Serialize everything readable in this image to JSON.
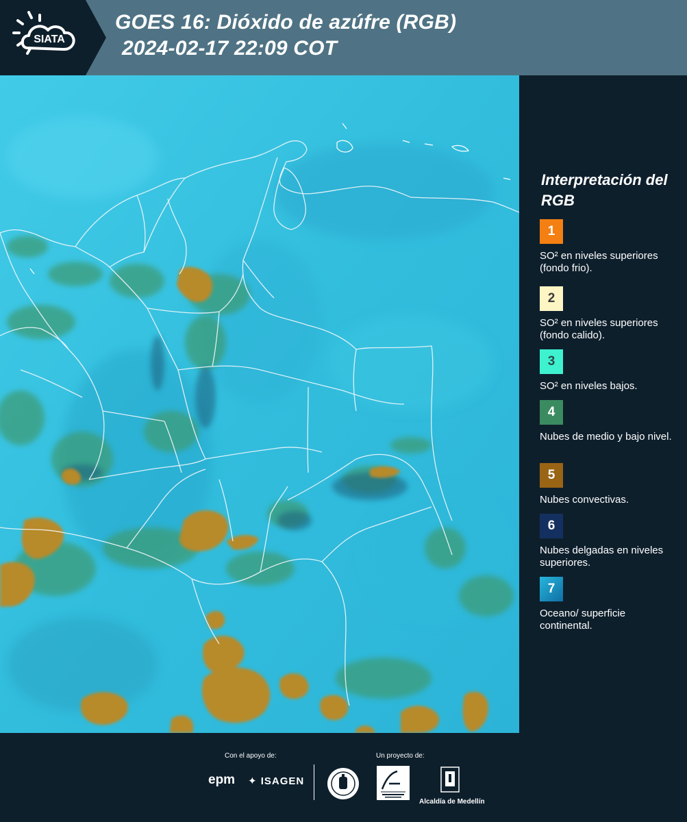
{
  "header": {
    "brand": "SIATA",
    "title_line1": "GOES 16: Dióxido de azúfre (RGB)",
    "title_line2": "2024-02-17 22:09 COT"
  },
  "legend": {
    "title": "Interpretación del RGB",
    "items": [
      {
        "number": "1",
        "color": "#f47f12",
        "label": "SO² en niveles superiores (fondo frio)."
      },
      {
        "number": "2",
        "color": "#fdf5c3",
        "label": "SO² en niveles superiores (fondo calido)."
      },
      {
        "number": "3",
        "color": "#3ff2cf",
        "label": "SO² en niveles bajos."
      },
      {
        "number": "4",
        "color": "#3b8b61",
        "label": "Nubes de medio y bajo nivel."
      },
      {
        "number": "5",
        "color": "#9a6415",
        "label": "Nubes convectivas."
      },
      {
        "number": "6",
        "color": "#143060",
        "label": "Nubes delgadas en niveles superiores."
      },
      {
        "number": "7",
        "color": "#1a8fbf",
        "label": "Oceano/ superficie continental."
      }
    ]
  },
  "footer": {
    "support_caption": "Con el apoyo de:",
    "project_caption": "Un proyecto de:",
    "sponsors": [
      "epm",
      "ISAGEN"
    ],
    "partners": [
      "Área Metropolitana Valle de Aburrá",
      "Alcaldía de Medellín"
    ],
    "alcaldia_text": "Alcaldía de Medellín"
  },
  "map": {
    "base_color": "#36c3e2",
    "convective_color": "#b38a2a",
    "lowcloud_color": "#3a9a78"
  }
}
